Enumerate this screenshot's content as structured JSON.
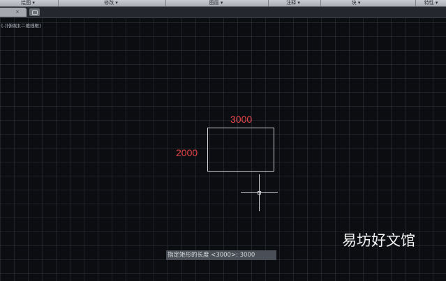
{
  "ribbon": {
    "panels": [
      {
        "label": "绘图 ▾"
      },
      {
        "label": "修改 ▾"
      },
      {
        "label": "图层 ▾"
      },
      {
        "label": "注释 ▾"
      },
      {
        "label": "块 ▾"
      },
      {
        "label": "特性 ▾"
      }
    ]
  },
  "tabs": {
    "close_glyph": "×"
  },
  "viewport": {
    "label": "[-][俯视][二维线框]"
  },
  "drawing": {
    "dim_width": "3000",
    "dim_height": "2000"
  },
  "command": {
    "prompt": "指定矩形的长度 <3000>: 3000"
  },
  "watermark": {
    "text": "易坊好文馆"
  },
  "colors": {
    "dimension": "#e8464b",
    "canvas": "#0b0d11",
    "geometry": "#d2d4d8"
  }
}
